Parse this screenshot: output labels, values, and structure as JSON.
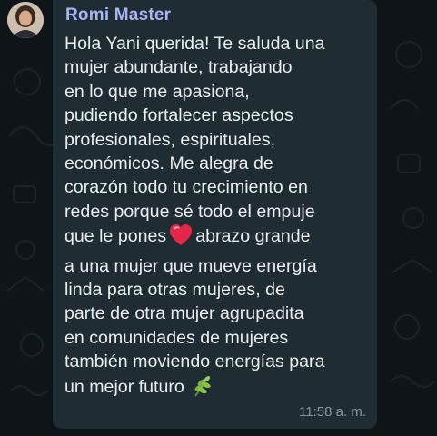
{
  "message": {
    "sender": "Romi Master",
    "lines": [
      "Hola Yani querida! Te saluda una",
      "mujer abundante, trabajando",
      "en lo que me apasiona,",
      "pudiendo fortalecer aspectos",
      "profesionales, espirituales,",
      "económicos. Me alegra de",
      "corazón todo tu crecimiento en",
      "redes porque sé todo el empuje",
      "que le pones",
      "abrazo grande",
      "a una mujer que mueve energía",
      "linda para otras mujeres, de",
      "parte de otra mujer agrupadita",
      "en comunidades de mujeres",
      "también moviendo energías para",
      "un mejor futuro"
    ],
    "emojis": [
      "heart-emoji",
      "herb-emoji"
    ],
    "time": "11:58 a. m."
  },
  "colors": {
    "background": "#0e1418",
    "bubble": "#1f2c33",
    "sender": "#a9b4f5",
    "text": "#e9edef",
    "timestamp": "#8696a0"
  }
}
